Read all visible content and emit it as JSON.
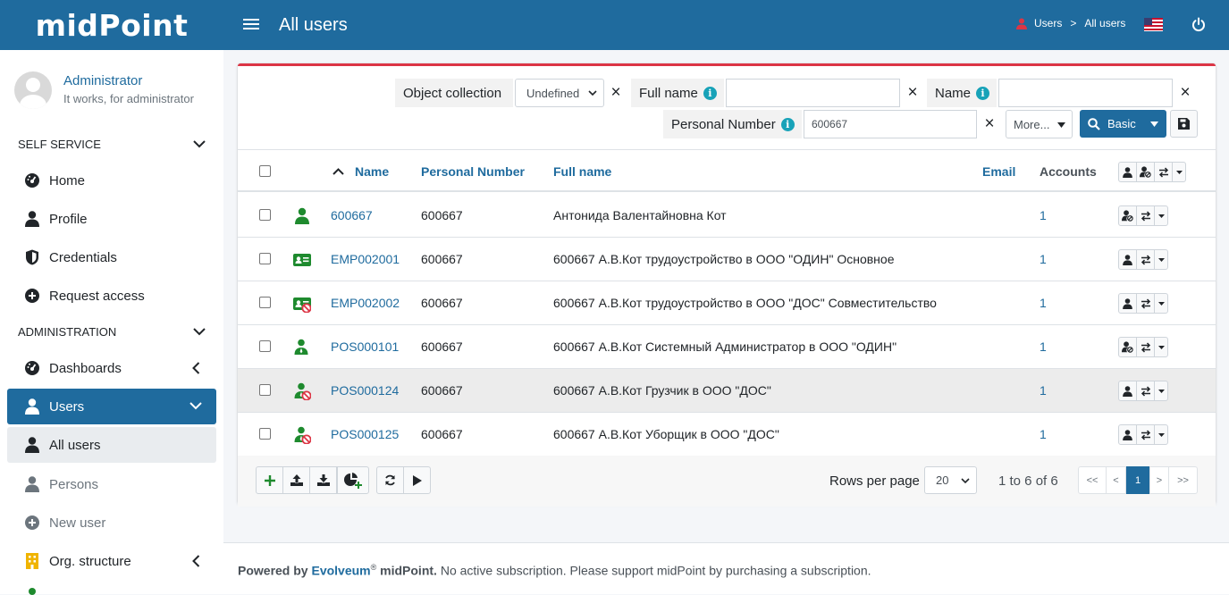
{
  "header": {
    "logo": "midPoint",
    "page_title": "All users",
    "breadcrumb": [
      "Users",
      ">",
      "All users"
    ]
  },
  "sidebar": {
    "user_name": "Administrator",
    "user_subtitle": "It works, for administrator",
    "sections": {
      "self_service": "SELF SERVICE",
      "administration": "ADMINISTRATION"
    },
    "items": {
      "home": "Home",
      "profile": "Profile",
      "credentials": "Credentials",
      "request_access": "Request access",
      "dashboards": "Dashboards",
      "users": "Users",
      "all_users": "All users",
      "persons": "Persons",
      "new_user": "New user",
      "org_structure": "Org. structure"
    }
  },
  "search": {
    "object_collection_label": "Object collection",
    "object_collection_value": "Undefined",
    "full_name_label": "Full name",
    "full_name_value": "",
    "name_label": "Name",
    "name_value": "",
    "personal_number_label": "Personal Number",
    "personal_number_value": "600667",
    "more_label": "More...",
    "basic_label": "Basic"
  },
  "table": {
    "columns": {
      "name": "Name",
      "personal_number": "Personal Number",
      "full_name": "Full name",
      "email": "Email",
      "accounts": "Accounts"
    },
    "rows": [
      {
        "icon": "person-icon",
        "name": "600667",
        "personal_number": "600667",
        "full_name": "Антонида Валентайновна Кот",
        "email": "",
        "accounts": "1"
      },
      {
        "icon": "id-card-icon",
        "name": "EMP002001",
        "personal_number": "600667",
        "full_name": "600667 А.В.Кот трудоустройство в ООО \"ОДИН\" Основное",
        "email": "",
        "accounts": "1"
      },
      {
        "icon": "id-card-disabled-icon",
        "name": "EMP002002",
        "personal_number": "600667",
        "full_name": "600667 А.В.Кот трудоустройство в ООО \"ДОС\" Совместительство",
        "email": "",
        "accounts": "1"
      },
      {
        "icon": "position-icon",
        "name": "POS000101",
        "personal_number": "600667",
        "full_name": "600667 А.В.Кот Системный Администратор в ООО \"ОДИН\"",
        "email": "",
        "accounts": "1"
      },
      {
        "icon": "position-disabled-icon",
        "name": "POS000124",
        "personal_number": "600667",
        "full_name": "600667 А.В.Кот Грузчик в ООО \"ДОС\"",
        "email": "",
        "accounts": "1"
      },
      {
        "icon": "position-disabled-icon",
        "name": "POS000125",
        "personal_number": "600667",
        "full_name": "600667 А.В.Кот Уборщик в ООО \"ДОС\"",
        "email": "",
        "accounts": "1"
      }
    ]
  },
  "pagination": {
    "rows_per_page_label": "Rows per page",
    "rows_per_page_value": "20",
    "range": "1 to 6 of 6",
    "first": "<<",
    "prev": "<",
    "page": "1",
    "next": ">",
    "last": ">>"
  },
  "footer": {
    "powered_by": "Powered by",
    "brand": "Evolveum",
    "reg": "®",
    "product": "midPoint.",
    "note": "No active subscription. Please support midPoint by purchasing a subscription."
  },
  "colors": {
    "primary": "#1f6b9e",
    "accent_border": "#dc3545",
    "green": "#1e8a2e",
    "red": "#dc3545"
  }
}
